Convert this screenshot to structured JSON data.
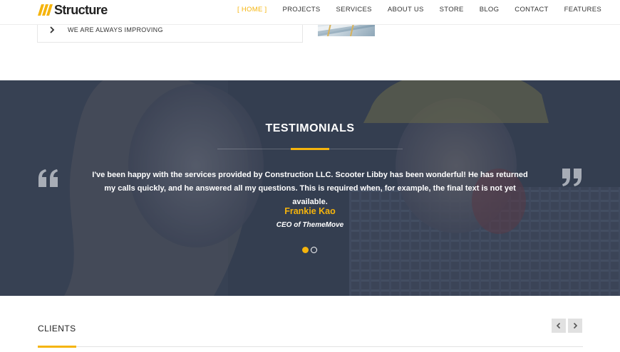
{
  "brand": {
    "name": "Structure",
    "accent": "#f5b40c"
  },
  "nav": {
    "items": [
      {
        "label": "[ HOME ]",
        "active": true
      },
      {
        "label": "PROJECTS",
        "active": false
      },
      {
        "label": "SERVICES",
        "active": false
      },
      {
        "label": "ABOUT US",
        "active": false
      },
      {
        "label": "STORE",
        "active": false
      },
      {
        "label": "BLOG",
        "active": false
      },
      {
        "label": "CONTACT",
        "active": false
      },
      {
        "label": "FEATURES",
        "active": false
      }
    ]
  },
  "features": {
    "item_label": "WE ARE ALWAYS IMPROVING",
    "item_icon": "chevron-right-icon"
  },
  "testimonials": {
    "title": "TESTIMONIALS",
    "quote": "I've been happy with the services provided by Construction LLC. Scooter Libby has been wonderful! He has returned my calls quickly, and he answered all my questions. This is required when, for example, the final text is not yet available.",
    "author": "Frankie Kao",
    "role": "CEO of ThemeMove",
    "open_quote_icon": "quote-open-icon",
    "close_quote_icon": "quote-close-icon",
    "slide_count": 2,
    "active_slide": 1
  },
  "clients": {
    "title": "CLIENTS",
    "prev_icon": "chevron-left-icon",
    "next_icon": "chevron-right-icon"
  }
}
